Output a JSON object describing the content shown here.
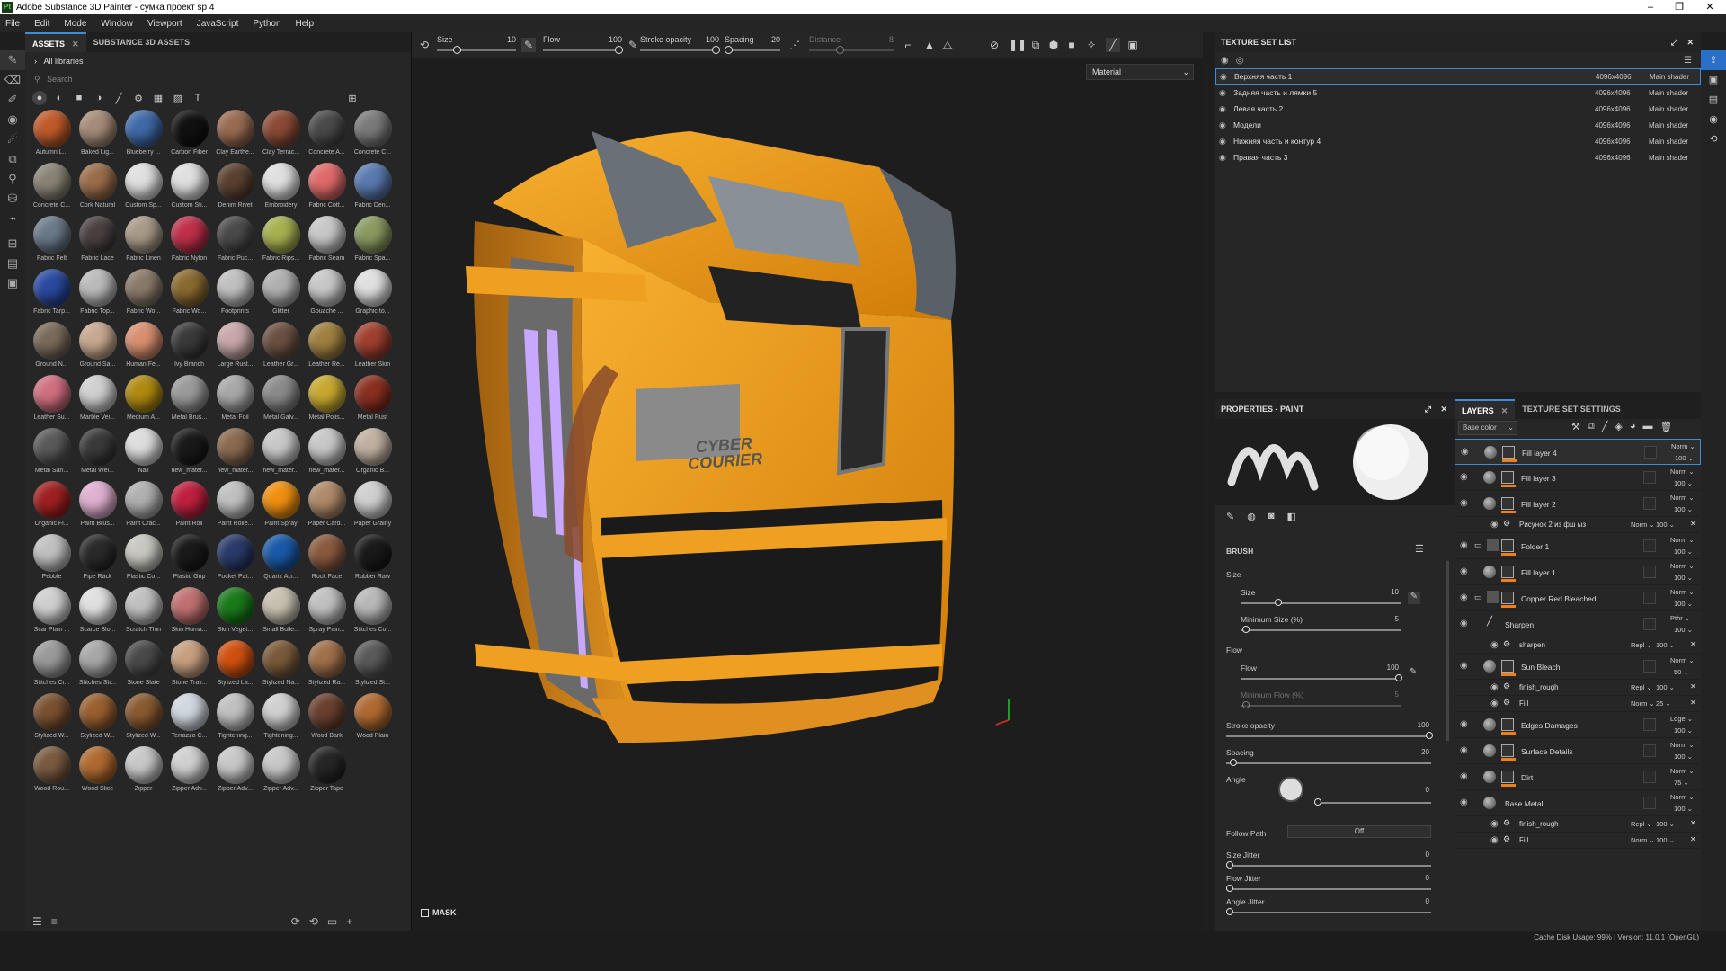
{
  "app": {
    "title": "Adobe Substance 3D Painter - сумка проект sp 4",
    "window_controls": [
      "–",
      "❐",
      "✕"
    ]
  },
  "menu": [
    "File",
    "Edit",
    "Mode",
    "Window",
    "Viewport",
    "JavaScript",
    "Python",
    "Help"
  ],
  "assets_panel": {
    "tabs": [
      {
        "label": "ASSETS",
        "active": true
      },
      {
        "label": "SUBSTANCE 3D ASSETS",
        "active": false
      }
    ],
    "libraries": "All libraries",
    "search_placeholder": "Search",
    "materials": [
      {
        "label": "Autumn L...",
        "color": "#c05a2a"
      },
      {
        "label": "Baked Lig...",
        "color": "#a58c78"
      },
      {
        "label": "Blueberry ...",
        "color": "#3f6aa8"
      },
      {
        "label": "Carbon Fiber",
        "color": "#111111"
      },
      {
        "label": "Clay Earthe...",
        "color": "#9a6b52"
      },
      {
        "label": "Clay Terrac...",
        "color": "#8b4a35"
      },
      {
        "label": "Concrete A...",
        "color": "#4a4a4a"
      },
      {
        "label": "Concrete C...",
        "color": "#7a7a7a"
      },
      {
        "label": "Concrete C...",
        "color": "#8a8476"
      },
      {
        "label": "Cork Natural",
        "color": "#9a6d4a"
      },
      {
        "label": "Custom Sp...",
        "color": "#e0e0e0"
      },
      {
        "label": "Custom Sti...",
        "color": "#e0e0e0"
      },
      {
        "label": "Denim Rivet",
        "color": "#5a4030"
      },
      {
        "label": "Embroidery",
        "color": "#e0e0e0"
      },
      {
        "label": "Fabric Cott...",
        "color": "#e06a6a"
      },
      {
        "label": "Fabric Den...",
        "color": "#5a7ab0"
      },
      {
        "label": "Fabric Felt",
        "color": "#6a7a8a"
      },
      {
        "label": "Fabric Lace",
        "color": "#4a4040"
      },
      {
        "label": "Fabric Linen",
        "color": "#a89a88"
      },
      {
        "label": "Fabric Nylon",
        "color": "#c0304a"
      },
      {
        "label": "Fabric Puc...",
        "color": "#4a4a4a"
      },
      {
        "label": "Fabric Rips...",
        "color": "#a8b050"
      },
      {
        "label": "Fabric Seam",
        "color": "#c8c8c8"
      },
      {
        "label": "Fabric Spa...",
        "color": "#8a9a60"
      },
      {
        "label": "Fabric Tarp...",
        "color": "#2a4aa0"
      },
      {
        "label": "Fabric Top...",
        "color": "#bbbbbb"
      },
      {
        "label": "Fabric Wo...",
        "color": "#8a7a6a"
      },
      {
        "label": "Fabric Wo...",
        "color": "#8a6a30"
      },
      {
        "label": "Footprints",
        "color": "#c0c0c0"
      },
      {
        "label": "Glitter",
        "color": "#b0b0b0"
      },
      {
        "label": "Gouache ...",
        "color": "#c8c8c8"
      },
      {
        "label": "Graphic to...",
        "color": "#e0e0e0"
      },
      {
        "label": "Ground N...",
        "color": "#7a6a5a"
      },
      {
        "label": "Ground Sa...",
        "color": "#c8a890"
      },
      {
        "label": "Human Fe...",
        "color": "#d89070"
      },
      {
        "label": "Ivy Branch",
        "color": "#3a3a3a"
      },
      {
        "label": "Large Rust...",
        "color": "#c8a8a8"
      },
      {
        "label": "Leather Gr...",
        "color": "#6a5040"
      },
      {
        "label": "Leather Re...",
        "color": "#a08040"
      },
      {
        "label": "Leather Skin",
        "color": "#a04030"
      },
      {
        "label": "Leather Su...",
        "color": "#d07080"
      },
      {
        "label": "Marble Vei...",
        "color": "#d0d0d0"
      },
      {
        "label": "Medium A...",
        "color": "#b08a10"
      },
      {
        "label": "Metal Brus...",
        "color": "#9a9a9a"
      },
      {
        "label": "Metal Foil",
        "color": "#a8a8a8"
      },
      {
        "label": "Metal Galv...",
        "color": "#8a8a8a"
      },
      {
        "label": "Metal Polis...",
        "color": "#c8a830"
      },
      {
        "label": "Metal Rust",
        "color": "#8a3020"
      },
      {
        "label": "Metal San...",
        "color": "#5a5a5a"
      },
      {
        "label": "Metal Wel...",
        "color": "#3a3a3a"
      },
      {
        "label": "Nail",
        "color": "#dddddd"
      },
      {
        "label": "new_mater...",
        "color": "#1a1a1a"
      },
      {
        "label": "new_mater...",
        "color": "#8a6a50"
      },
      {
        "label": "new_mater...",
        "color": "#c8c8c8"
      },
      {
        "label": "new_mater...",
        "color": "#c8c8c8"
      },
      {
        "label": "Organic B...",
        "color": "#c0b0a0"
      },
      {
        "label": "Organic Fl...",
        "color": "#a02020"
      },
      {
        "label": "Paint Brus...",
        "color": "#e0b0d0"
      },
      {
        "label": "Paint Crac...",
        "color": "#b0b0b0"
      },
      {
        "label": "Paint Roll",
        "color": "#c02040"
      },
      {
        "label": "Paint Rolle...",
        "color": "#c0c0c0"
      },
      {
        "label": "Paint Spray",
        "color": "#f09010"
      },
      {
        "label": "Paper Card...",
        "color": "#b08a6a"
      },
      {
        "label": "Paper Grainy",
        "color": "#d0d0d0"
      },
      {
        "label": "Pebble",
        "color": "#c0c0c0"
      },
      {
        "label": "Pipe Rack",
        "color": "#2a2a2a"
      },
      {
        "label": "Plastic Co...",
        "color": "#c8c8c0"
      },
      {
        "label": "Plastic Grip",
        "color": "#1a1a1a"
      },
      {
        "label": "Pocket Pat...",
        "color": "#2a3a6a"
      },
      {
        "label": "Quartz Acr...",
        "color": "#1a5aa8"
      },
      {
        "label": "Rock Face",
        "color": "#8a5a40"
      },
      {
        "label": "Rubber Raw",
        "color": "#1a1a1a"
      },
      {
        "label": "Scar Plain ...",
        "color": "#d0d0d0"
      },
      {
        "label": "Scarce Blo...",
        "color": "#e0e0e0"
      },
      {
        "label": "Scratch Thin",
        "color": "#c0c0c0"
      },
      {
        "label": "Skin Huma...",
        "color": "#c07070"
      },
      {
        "label": "Skin Veget...",
        "color": "#1a7a1a"
      },
      {
        "label": "Small Bulle...",
        "color": "#c8c0b0"
      },
      {
        "label": "Spray Pain...",
        "color": "#c0c0c0"
      },
      {
        "label": "Stitches Co...",
        "color": "#b8b8b8"
      },
      {
        "label": "Stitches Cr...",
        "color": "#9a9a9a"
      },
      {
        "label": "Stitches Str...",
        "color": "#a8a8a8"
      },
      {
        "label": "Stone Slate",
        "color": "#4a4a4a"
      },
      {
        "label": "Stone Trav...",
        "color": "#c8a080"
      },
      {
        "label": "Stylized La...",
        "color": "#d05010"
      },
      {
        "label": "Stylized Na...",
        "color": "#7a5a3a"
      },
      {
        "label": "Stylized Ra...",
        "color": "#a0704a"
      },
      {
        "label": "Stylized St...",
        "color": "#5a5a5a"
      },
      {
        "label": "Stylized W...",
        "color": "#7a5030"
      },
      {
        "label": "Stylized W...",
        "color": "#9a6030"
      },
      {
        "label": "Stylized W...",
        "color": "#8a5a30"
      },
      {
        "label": "Terrazzo C...",
        "color": "#d0d8e0"
      },
      {
        "label": "Tightening...",
        "color": "#c0c0c0"
      },
      {
        "label": "Tightening...",
        "color": "#d0d0d0"
      },
      {
        "label": "Wood Bark",
        "color": "#6a4030"
      },
      {
        "label": "Wood Plain",
        "color": "#b06a30"
      },
      {
        "label": "Wood Rou...",
        "color": "#7a5a40"
      },
      {
        "label": "Wood Slice",
        "color": "#b06a30"
      },
      {
        "label": "Zipper",
        "color": "#c8c8c8"
      },
      {
        "label": "Zipper Adv...",
        "color": "#d0d0d0"
      },
      {
        "label": "Zipper Adv...",
        "color": "#c8c8c8"
      },
      {
        "label": "Zipper Adv...",
        "color": "#c8c8c8"
      },
      {
        "label": "Zipper Tape",
        "color": "#262626"
      }
    ]
  },
  "toolbar": {
    "size_label": "Size",
    "size_value": "10",
    "flow_label": "Flow",
    "flow_value": "100",
    "stroke_label": "Stroke opacity",
    "stroke_value": "100",
    "spacing_label": "Spacing",
    "spacing_value": "20",
    "distance_label": "Distance",
    "distance_value": "8"
  },
  "viewport": {
    "channel_select": "Material",
    "mask_label": "MASK",
    "plate_text": "CYBER COURIER"
  },
  "texture_set_list": {
    "title": "TEXTURE SET LIST",
    "rows": [
      {
        "name": "Верхняя часть 1",
        "res": "4096x4096",
        "shader": "Main shader",
        "selected": true
      },
      {
        "name": "Задняя часть и лямки 5",
        "res": "4096x4096",
        "shader": "Main shader",
        "selected": false
      },
      {
        "name": "Левая часть 2",
        "res": "4096x4096",
        "shader": "Main shader",
        "selected": false
      },
      {
        "name": "Модели",
        "res": "4096x4096",
        "shader": "Main shader",
        "selected": false
      },
      {
        "name": "Нижняя часть и контур 4",
        "res": "4096x4096",
        "shader": "Main shader",
        "selected": false
      },
      {
        "name": "Правая часть 3",
        "res": "4096x4096",
        "shader": "Main shader",
        "selected": false
      }
    ]
  },
  "properties": {
    "title": "PROPERTIES - PAINT",
    "brush_section": "BRUSH",
    "size_group": "Size",
    "size_label": "Size",
    "size_value": "10",
    "min_size_label": "Minimum Size (%)",
    "min_size_value": "5",
    "flow_group": "Flow",
    "flow_label": "Flow",
    "flow_value": "100",
    "min_flow_label": "Minimum Flow (%)",
    "min_flow_value": "5",
    "stroke_label": "Stroke opacity",
    "stroke_value": "100",
    "spacing_label": "Spacing",
    "spacing_value": "20",
    "angle_label": "Angle",
    "angle_value": "0",
    "follow_label": "Follow Path",
    "follow_value": "Off",
    "size_jitter_label": "Size Jitter",
    "size_jitter_value": "0",
    "flow_jitter_label": "Flow Jitter",
    "flow_jitter_value": "0",
    "angle_jitter_label": "Angle Jitter",
    "angle_jitter_value": "0"
  },
  "layers": {
    "tabs": [
      {
        "label": "LAYERS",
        "active": true
      },
      {
        "label": "TEXTURE SET SETTINGS",
        "active": false
      }
    ],
    "channel": "Base color",
    "rows": [
      {
        "name": "Fill layer 4",
        "blend": "Norm",
        "opacity": "100",
        "kind": "fill",
        "selected": true
      },
      {
        "name": "Fill layer 3",
        "blend": "Norm",
        "opacity": "100",
        "kind": "fill"
      },
      {
        "name": "Fill layer 2",
        "blend": "Norm",
        "opacity": "100",
        "kind": "fill"
      },
      {
        "name": "Рисунок 2 из фш ыз",
        "blend": "Norm",
        "opacity": "100",
        "kind": "sub"
      },
      {
        "name": "Folder 1",
        "blend": "Norm",
        "opacity": "100",
        "kind": "folder"
      },
      {
        "name": "Fill layer 1",
        "blend": "Norm",
        "opacity": "100",
        "kind": "fill"
      },
      {
        "name": "Copper Red Bleached",
        "blend": "Norm",
        "opacity": "100",
        "kind": "folder"
      },
      {
        "name": "Sharpen",
        "blend": "Pthr",
        "opacity": "100",
        "kind": "filter"
      },
      {
        "name": "sharpen",
        "blend": "Repl",
        "opacity": "100",
        "kind": "sub"
      },
      {
        "name": "Sun Bleach",
        "blend": "Norm",
        "opacity": "50",
        "kind": "fill"
      },
      {
        "name": "finish_rough",
        "blend": "Repl",
        "opacity": "100",
        "kind": "sub"
      },
      {
        "name": "Fill",
        "blend": "Norm",
        "opacity": "25",
        "kind": "sub"
      },
      {
        "name": "Edges Damages",
        "blend": "Ldge",
        "opacity": "100",
        "kind": "fill"
      },
      {
        "name": "Surface Details",
        "blend": "Norm",
        "opacity": "100",
        "kind": "fill"
      },
      {
        "name": "Dirt",
        "blend": "Norm",
        "opacity": "75",
        "kind": "fill"
      },
      {
        "name": "Base Metal",
        "blend": "Norm",
        "opacity": "100",
        "kind": "plain"
      },
      {
        "name": "finish_rough",
        "blend": "Repl",
        "opacity": "100",
        "kind": "sub"
      },
      {
        "name": "Fill",
        "blend": "Norm",
        "opacity": "100",
        "kind": "sub"
      }
    ]
  },
  "status": {
    "text": "Cache Disk Usage:  99% | Version: 11.0.1 (OpenGL)"
  },
  "colors": {
    "accent": "#3a8fd8",
    "bag_orange": "#f0a020",
    "highlight": "#f07f1a"
  }
}
